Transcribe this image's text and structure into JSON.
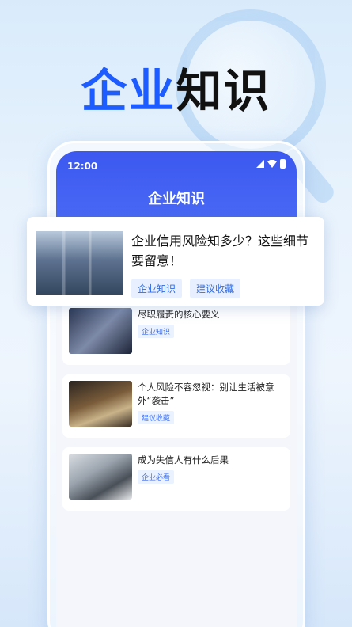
{
  "hero": {
    "title_blue": "企业",
    "title_dark": "知识"
  },
  "status": {
    "time": "12:00"
  },
  "appbar": {
    "title": "企业知识"
  },
  "featured": {
    "title": "企业信用风险知多少？这些细节要留意！",
    "tags": [
      "企业知识",
      "建议收藏"
    ]
  },
  "articles": [
    {
      "title": "尽职履责的核心要义",
      "tag": "企业知识",
      "thumb": "keyboard-image"
    },
    {
      "title": "个人风险不容忽视：别让生活被意外“袭击”",
      "tag": "建议收藏",
      "thumb": "laptop-image"
    },
    {
      "title": "成为失信人有什么后果",
      "tag": "企业必看",
      "thumb": "worried-man-image"
    }
  ],
  "colors": {
    "accent": "#3c58f0",
    "hero_blue": "#1d5cff",
    "tag_blue": "#3b6ff0"
  }
}
